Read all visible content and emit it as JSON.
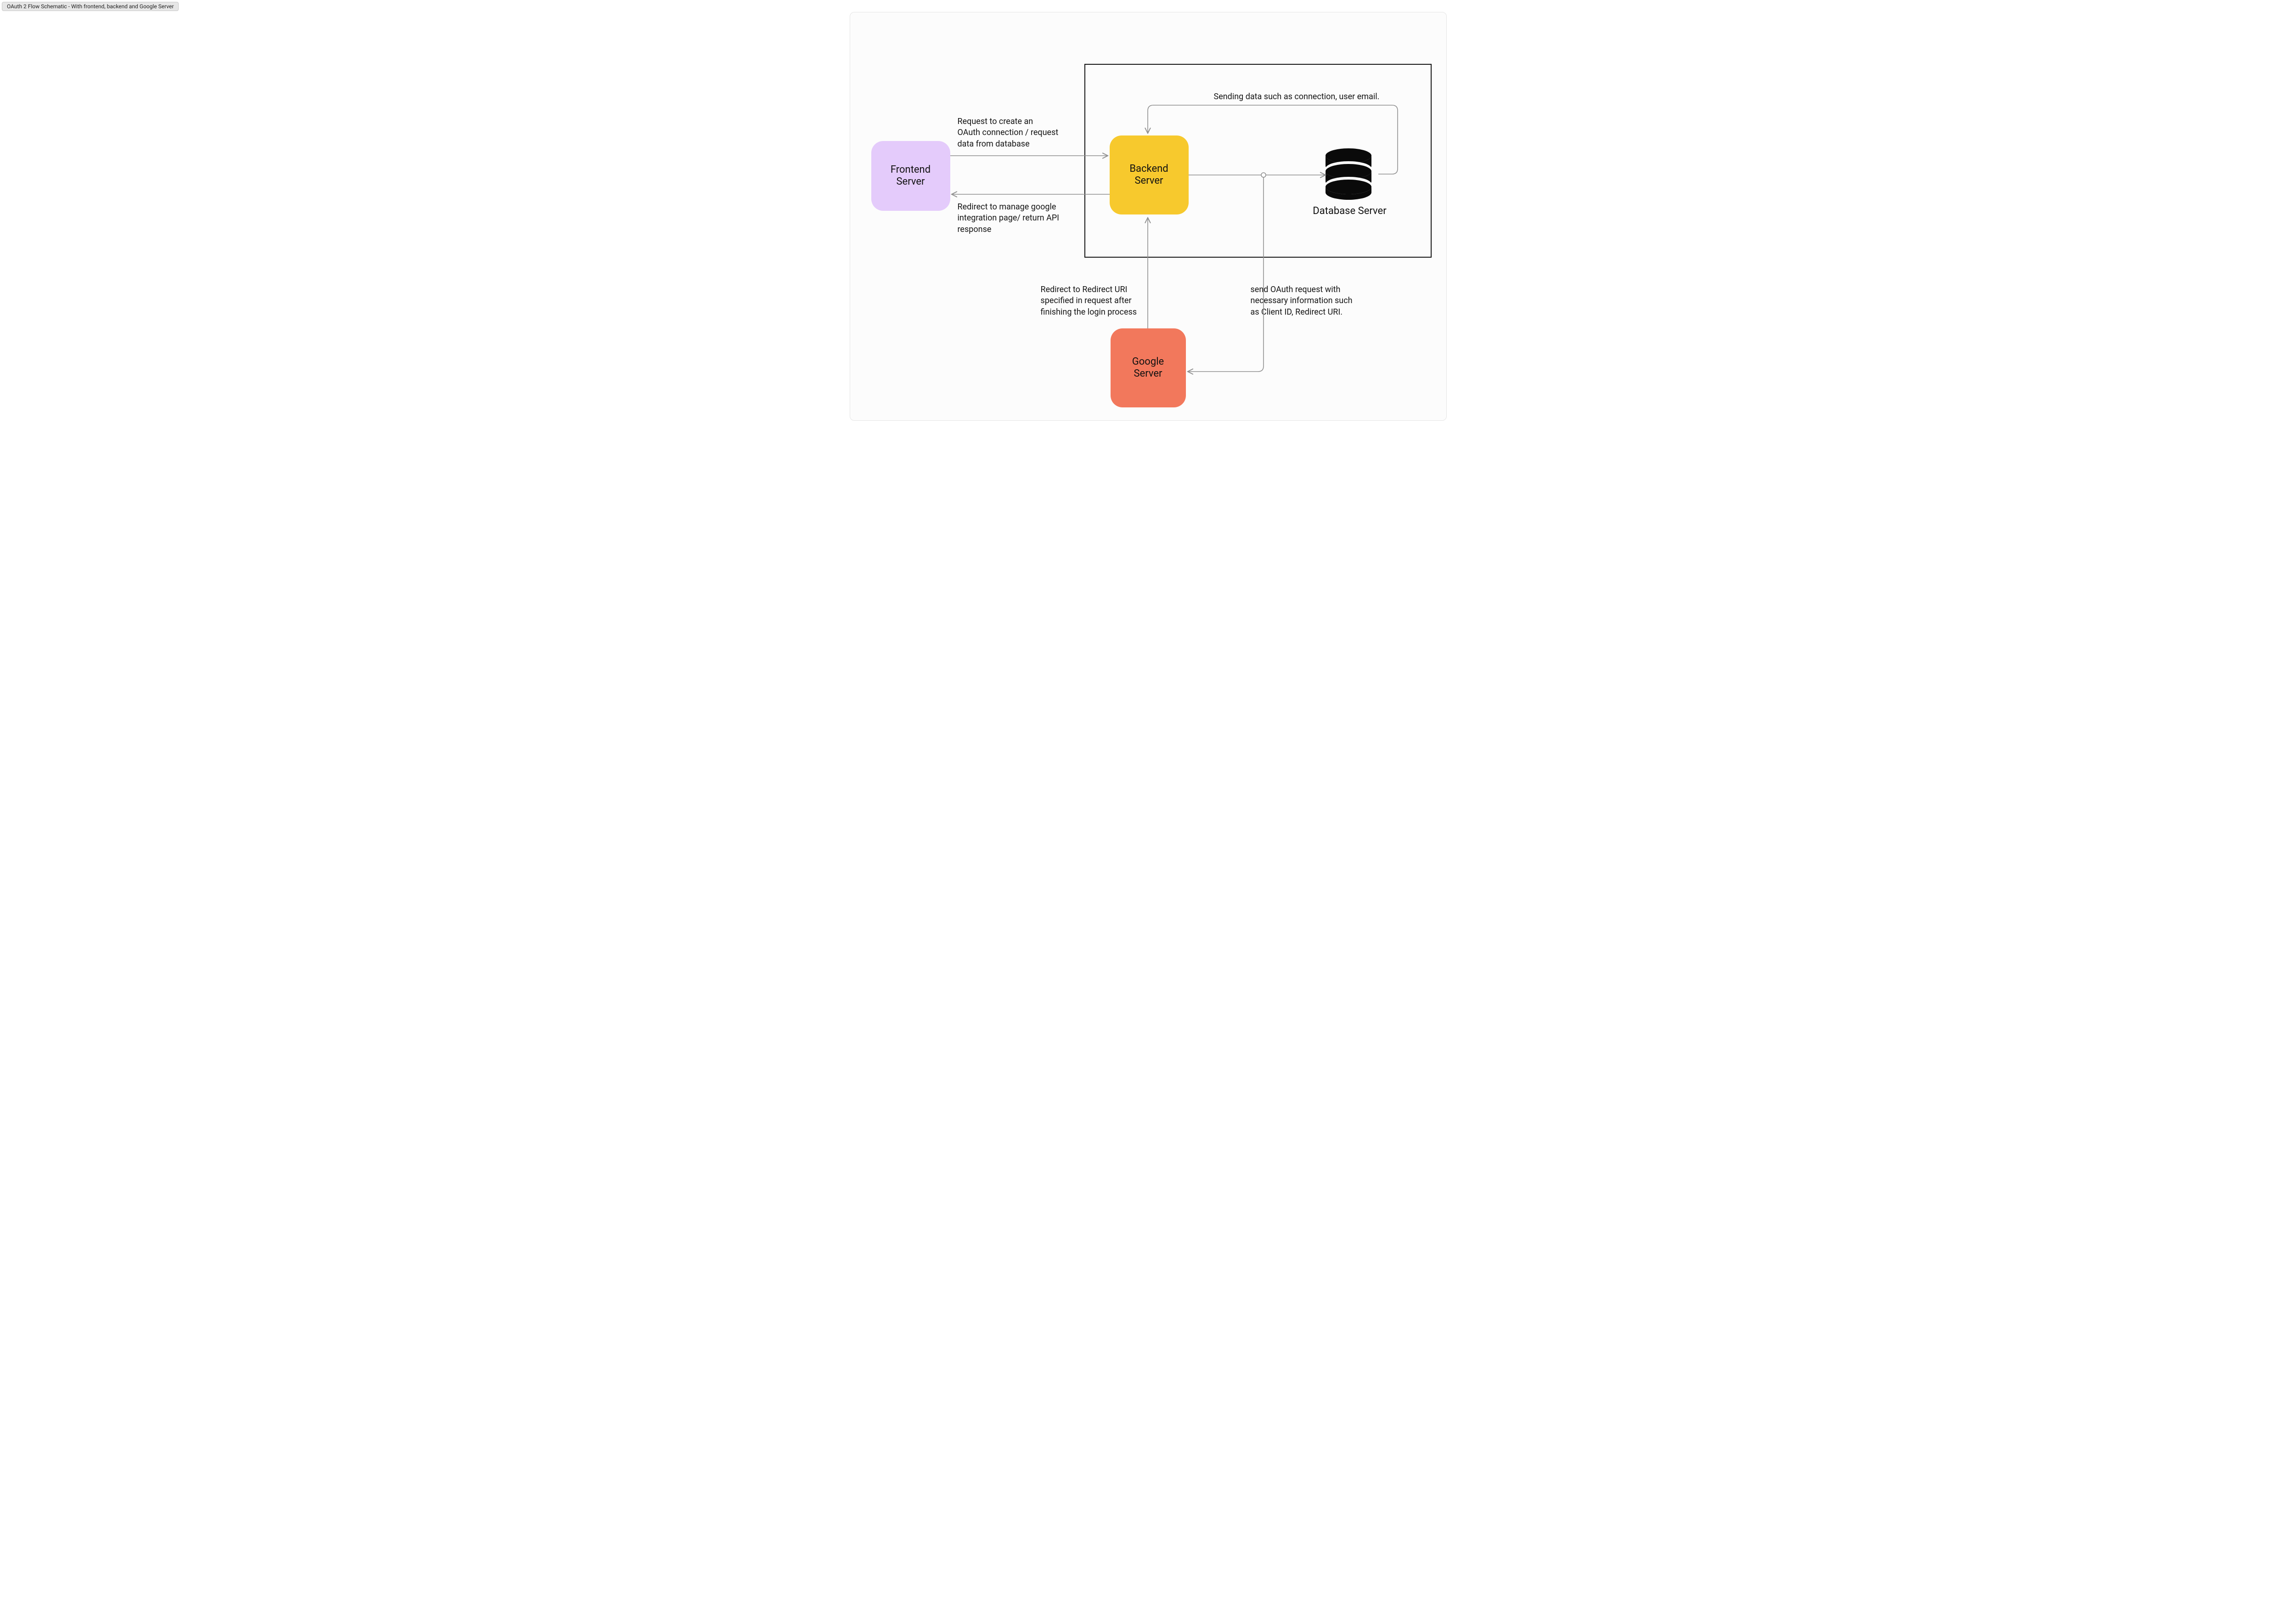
{
  "title": "OAuth 2 Flow Schematic - With frontend, backend and Google Server",
  "nodes": {
    "frontend": "Frontend\nServer",
    "backend": "Backend\nServer",
    "google": "Google\nServer",
    "database": "Database Server"
  },
  "flows": {
    "request_create": "Request to create an\nOAuth connection / request\ndata from database",
    "redirect_manage": "Redirect to manage google\nintegration page/ return API\nresponse",
    "sending_data": "Sending data such as connection, user email.",
    "redirect_uri": "Redirect to Redirect URI\nspecified in request after\nfinishing the login process",
    "send_oauth": "send OAuth request with\nnecessary information such\nas Client ID, Redirect URI."
  },
  "colors": {
    "frontend": "#e4cbfb",
    "backend": "#f7c92d",
    "google": "#f2785c",
    "arrow": "#909090",
    "database": "#0a0a0a"
  }
}
